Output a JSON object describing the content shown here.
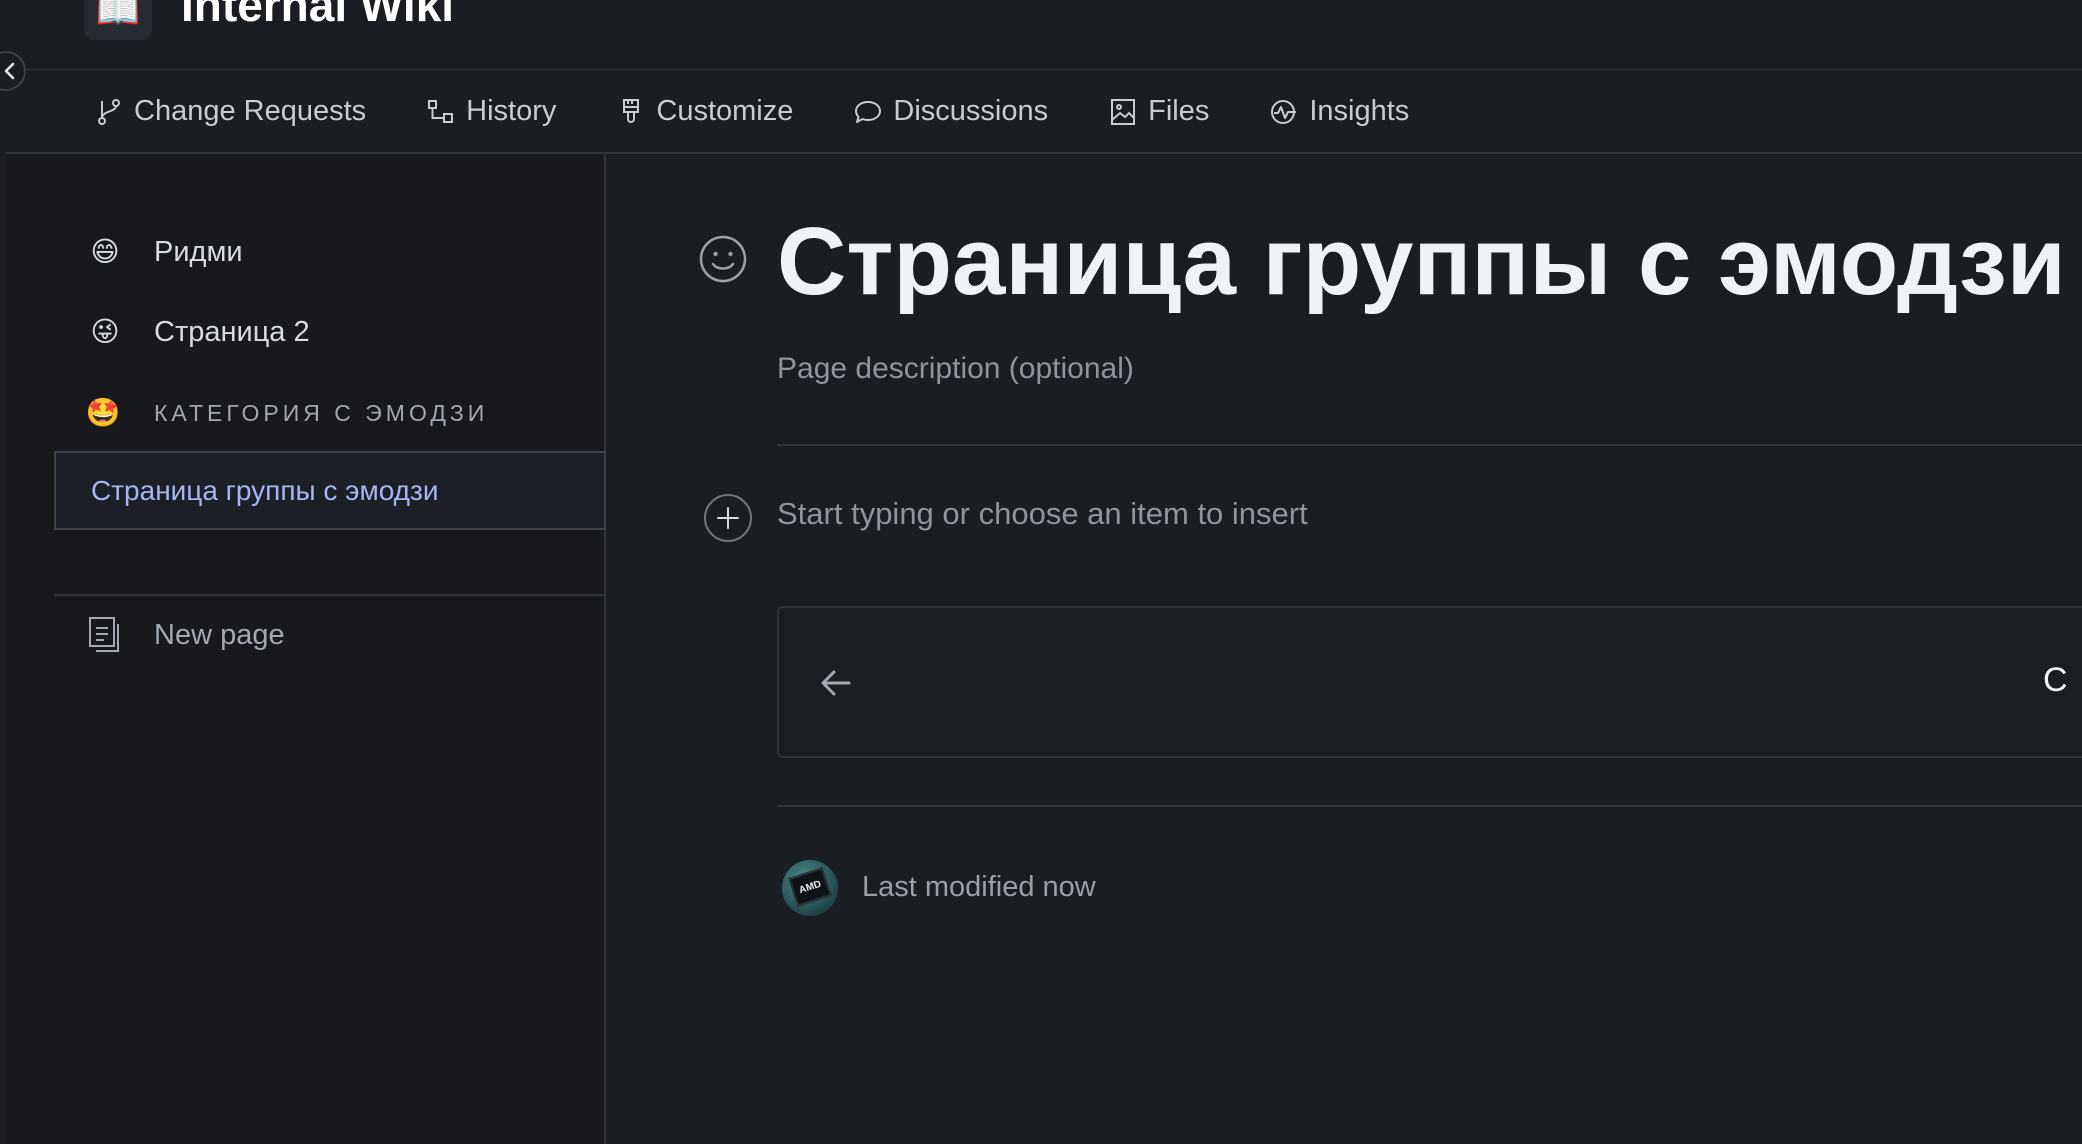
{
  "header": {
    "space_logo": "📖",
    "space_title": "Internal Wiki"
  },
  "tabs": [
    {
      "label": "Change Requests",
      "icon": "git-branch-icon"
    },
    {
      "label": "History",
      "icon": "history-icon"
    },
    {
      "label": "Customize",
      "icon": "paintbrush-icon"
    },
    {
      "label": "Discussions",
      "icon": "chat-bubble-icon"
    },
    {
      "label": "Files",
      "icon": "image-file-icon"
    },
    {
      "label": "Insights",
      "icon": "insights-icon"
    }
  ],
  "sidebar": {
    "items": [
      {
        "emoji": "😄",
        "label": "Ридми"
      },
      {
        "emoji": "😜",
        "label": "Страница 2"
      }
    ],
    "category": {
      "emoji": "🤩",
      "label": "КАТЕГОРИЯ С ЭМОДЗИ"
    },
    "active_item": "Страница группы с эмодзи",
    "new_page_label": "New page"
  },
  "page": {
    "title": "Страница группы с эмодзи",
    "description_placeholder": "Page description (optional)",
    "editor_placeholder": "Start typing or choose an item to insert",
    "nav_card_next_char": "С",
    "last_modified": "Last modified now",
    "avatar_text": "AMD"
  },
  "colors": {
    "background": "#1a1d21",
    "sidebar": "#17191d",
    "active_link": "#a6b6f4",
    "title": "#eef3f6"
  }
}
